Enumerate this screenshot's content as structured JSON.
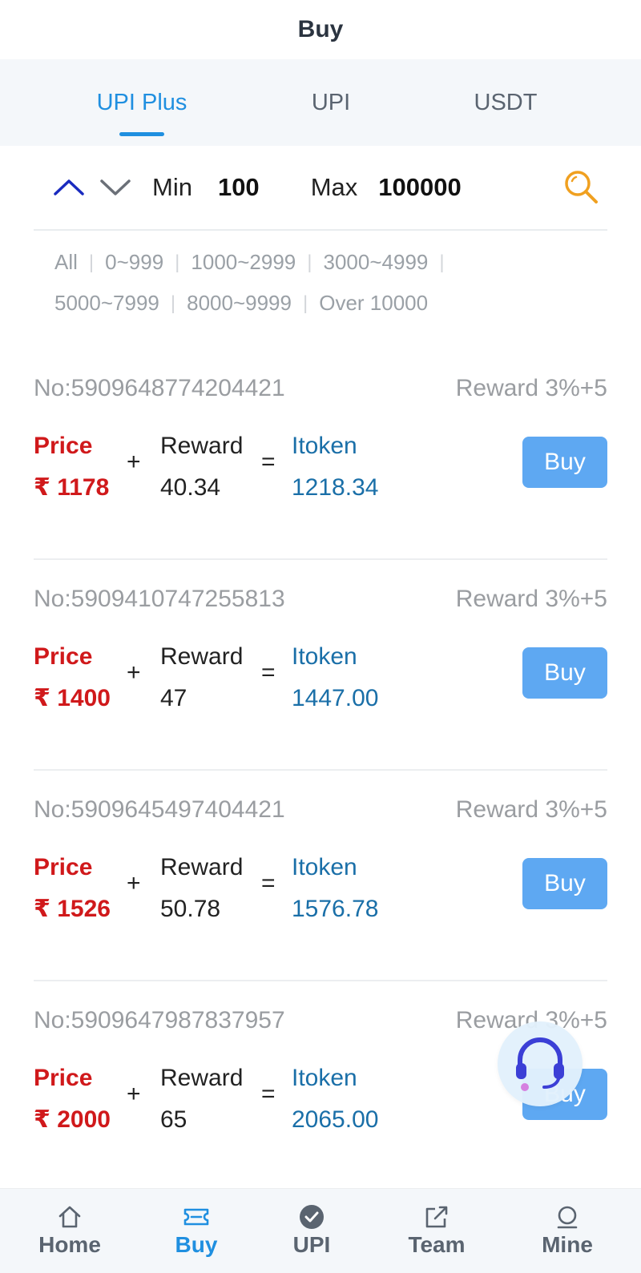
{
  "header": {
    "title": "Buy"
  },
  "tabs": [
    {
      "label": "UPI Plus",
      "active": true
    },
    {
      "label": "UPI",
      "active": false
    },
    {
      "label": "USDT",
      "active": false
    }
  ],
  "filter": {
    "min_label": "Min",
    "min_value": "100",
    "max_label": "Max",
    "max_value": "100000"
  },
  "chips": [
    "All",
    "0~999",
    "1000~2999",
    "3000~4999",
    "5000~7999",
    "8000~9999",
    "Over 10000"
  ],
  "orders": [
    {
      "no": "No:5909648774204421",
      "reward_rate": "Reward 3%+5",
      "price_label": "Price",
      "price": "₹ 1178",
      "reward_label": "Reward",
      "reward": "40.34",
      "itoken_label": "Itoken",
      "itoken": "1218.34",
      "buy_label": "Buy"
    },
    {
      "no": "No:5909410747255813",
      "reward_rate": "Reward 3%+5",
      "price_label": "Price",
      "price": "₹ 1400",
      "reward_label": "Reward",
      "reward": "47",
      "itoken_label": "Itoken",
      "itoken": "1447.00",
      "buy_label": "Buy"
    },
    {
      "no": "No:5909645497404421",
      "reward_rate": "Reward 3%+5",
      "price_label": "Price",
      "price": "₹ 1526",
      "reward_label": "Reward",
      "reward": "50.78",
      "itoken_label": "Itoken",
      "itoken": "1576.78",
      "buy_label": "Buy"
    },
    {
      "no": "No:5909647987837957",
      "reward_rate": "Reward 3%+5",
      "price_label": "Price",
      "price": "₹ 2000",
      "reward_label": "Reward",
      "reward": "65",
      "itoken_label": "Itoken",
      "itoken": "2065.00",
      "buy_label": "Buy"
    }
  ],
  "symbols": {
    "plus": "+",
    "equals": "="
  },
  "nav": [
    {
      "label": "Home",
      "icon": "home-icon",
      "active": false
    },
    {
      "label": "Buy",
      "icon": "ticket-icon",
      "active": true
    },
    {
      "label": "UPI",
      "icon": "check-circle-icon",
      "active": false
    },
    {
      "label": "Team",
      "icon": "share-icon",
      "active": false
    },
    {
      "label": "Mine",
      "icon": "user-icon",
      "active": false
    }
  ],
  "colors": {
    "accent": "#1f8fe0",
    "price_red": "#d0191b",
    "itoken_blue": "#1a6fa8",
    "buy_button": "#5ea8f2",
    "search_icon": "#f0a020"
  }
}
